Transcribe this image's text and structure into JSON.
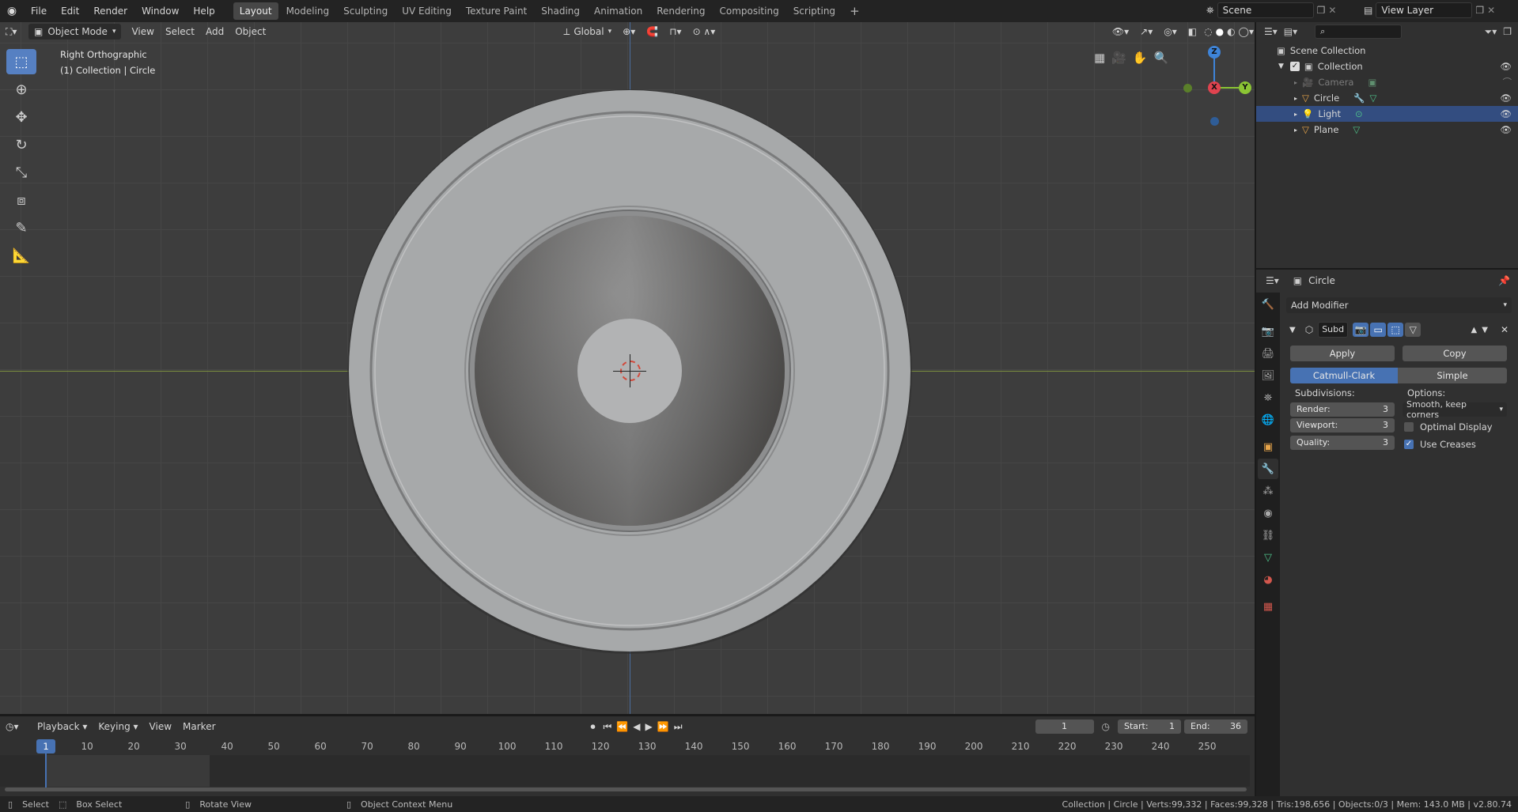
{
  "topbar": {
    "menus": [
      "File",
      "Edit",
      "Render",
      "Window",
      "Help"
    ],
    "workspaces": [
      "Layout",
      "Modeling",
      "Sculpting",
      "UV Editing",
      "Texture Paint",
      "Shading",
      "Animation",
      "Rendering",
      "Compositing",
      "Scripting"
    ],
    "active_workspace": "Layout",
    "add_tab": "+",
    "scene": "Scene",
    "view_layer": "View Layer"
  },
  "viewport": {
    "mode": "Object Mode",
    "menus": [
      "View",
      "Select",
      "Add",
      "Object"
    ],
    "orientation": "Global",
    "view_name": "Right Orthographic",
    "context": "(1) Collection | Circle",
    "gizmo": {
      "z": "Z",
      "y": "Y",
      "x": "X"
    }
  },
  "outliner": {
    "search_placeholder": "",
    "root": "Scene Collection",
    "collection": "Collection",
    "items": [
      {
        "label": "Camera"
      },
      {
        "label": "Circle"
      },
      {
        "label": "Light"
      },
      {
        "label": "Plane"
      }
    ]
  },
  "properties": {
    "object_name": "Circle",
    "add_modifier": "Add Modifier",
    "modifier_name": "Subd",
    "apply": "Apply",
    "copy": "Copy",
    "algorithm_catmull": "Catmull-Clark",
    "algorithm_simple": "Simple",
    "subdivisions_label": "Subdivisions:",
    "options_label": "Options:",
    "render_label": "Render:",
    "render_value": "3",
    "viewport_label": "Viewport:",
    "viewport_value": "3",
    "quality_label": "Quality:",
    "quality_value": "3",
    "uv_smooth": "Smooth, keep corners",
    "optimal_display": "Optimal Display",
    "use_creases": "Use Creases"
  },
  "timeline": {
    "menus": [
      "Playback",
      "Keying",
      "View",
      "Marker"
    ],
    "current_frame": "1",
    "start_label": "Start:",
    "start_value": "1",
    "end_label": "End:",
    "end_value": "36",
    "ruler_current": "1",
    "ruler_ticks": [
      "10",
      "20",
      "30",
      "40",
      "50",
      "60",
      "70",
      "80",
      "90",
      "100",
      "110",
      "120",
      "130",
      "140",
      "150",
      "160",
      "170",
      "180",
      "190",
      "200",
      "210",
      "220",
      "230",
      "240",
      "250"
    ]
  },
  "statusbar": {
    "select": "Select",
    "box_select": "Box Select",
    "rotate_view": "Rotate View",
    "context_menu": "Object Context Menu",
    "stats": "Collection | Circle | Verts:99,332 | Faces:99,328 | Tris:198,656 | Objects:0/3 | Mem: 143.0 MB | v2.80.74"
  },
  "colors": {
    "accent": "#4772b3",
    "selected_row": "#334d80",
    "x_axis": "#e0434f",
    "y_axis": "#8bc534",
    "z_axis": "#3e84d8"
  }
}
